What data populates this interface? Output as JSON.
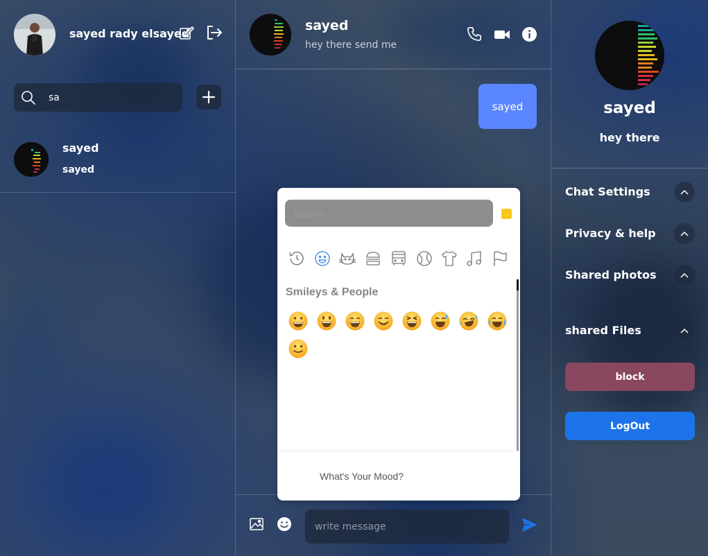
{
  "user": {
    "name": "sayed rady elsayed"
  },
  "search": {
    "value": "sa"
  },
  "contacts": [
    {
      "name": "sayed",
      "last_message": "sayed"
    }
  ],
  "chat": {
    "contact_name": "sayed",
    "contact_status": "hey there send me",
    "messages": [
      {
        "text": "sayed",
        "sent": true
      }
    ],
    "composer_placeholder": "write message"
  },
  "emoji_picker": {
    "search_placeholder": "Search",
    "categories": [
      "recent-icon",
      "smileys-icon",
      "animals-icon",
      "food-icon",
      "travel-icon",
      "activities-icon",
      "objects-icon",
      "symbols-icon",
      "flags-icon"
    ],
    "section_title": "Smileys & People",
    "emojis": [
      "😀",
      "😃",
      "😄",
      "😁",
      "😆",
      "😅",
      "🤣",
      "😂",
      "🙂"
    ],
    "footer_text": "What's Your Mood?",
    "skin_tone_color": "#f7c71c"
  },
  "profile": {
    "name": "sayed",
    "status": "hey there",
    "sections": [
      "Chat Settings",
      "Privacy & help",
      "Shared photos",
      "shared Files"
    ],
    "block_label": "block",
    "logout_label": "LogOut"
  },
  "colors": {
    "sent_bubble": "#5a86ff",
    "block_button": "#8a4760",
    "logout_button": "#1d74e8",
    "send_icon": "#1d74e8"
  }
}
